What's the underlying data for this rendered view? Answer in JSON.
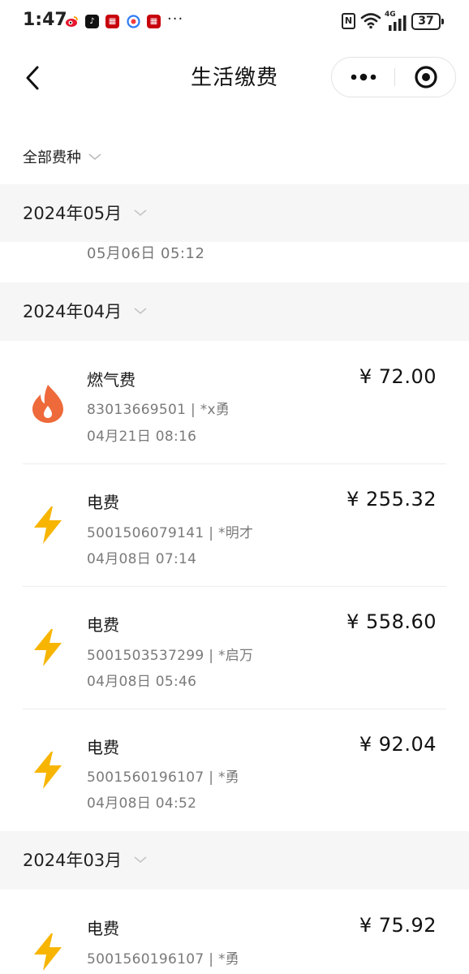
{
  "status_bar": {
    "time": "1:47",
    "app_icons": [
      "weibo-icon",
      "tiktok-icon",
      "huawei-icon",
      "browser-icon",
      "huawei-icon"
    ],
    "more": "···",
    "network": "4G",
    "battery": "37"
  },
  "nav": {
    "title": "生活缴费"
  },
  "filter": {
    "label": "全部费种"
  },
  "months": [
    {
      "label": "2024年05月",
      "partial_time": "05月06日 05:12"
    },
    {
      "label": "2024年04月",
      "bills": [
        {
          "icon": "flame-icon",
          "name": "燃气费",
          "account": "83013669501 | *x勇",
          "time": "04月21日 08:16",
          "amount": "¥ 72.00"
        },
        {
          "icon": "lightning-icon",
          "name": "电费",
          "account": "5001506079141 | *明才",
          "time": "04月08日 07:14",
          "amount": "¥ 255.32"
        },
        {
          "icon": "lightning-icon",
          "name": "电费",
          "account": "5001503537299 | *启万",
          "time": "04月08日 05:46",
          "amount": "¥ 558.60"
        },
        {
          "icon": "lightning-icon",
          "name": "电费",
          "account": "5001560196107 | *勇",
          "time": "04月08日 04:52",
          "amount": "¥ 92.04"
        }
      ]
    },
    {
      "label": "2024年03月",
      "bills": [
        {
          "icon": "lightning-icon",
          "name": "电费",
          "account": "5001560196107 | *勇",
          "amount": "¥ 75.92"
        }
      ]
    }
  ],
  "colors": {
    "flame": "#ee6a3b",
    "lightning": "#f7b500",
    "section_bg": "#f6f6f6"
  }
}
